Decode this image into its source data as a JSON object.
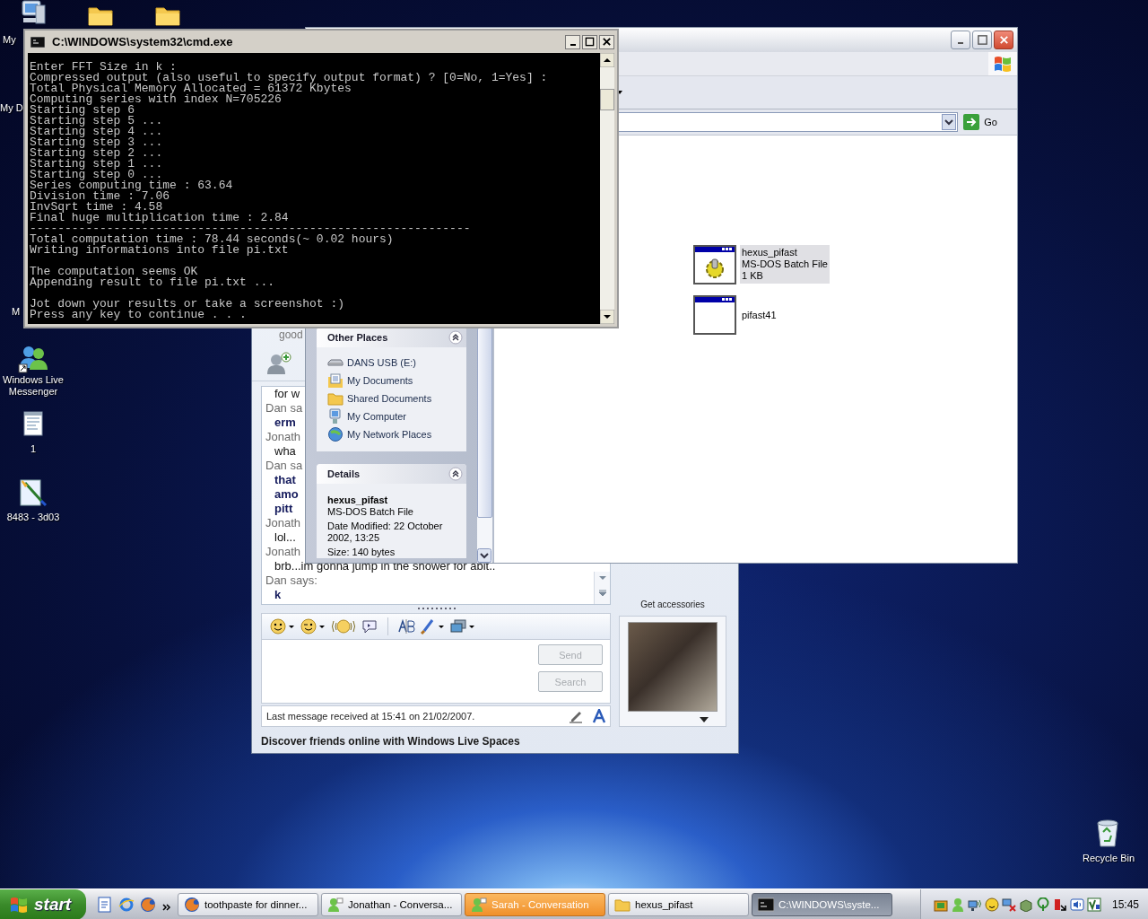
{
  "desktop_icons": [
    {
      "kind": "computer",
      "label": "My"
    },
    {
      "kind": "folder"
    },
    {
      "kind": "folder"
    },
    {
      "kind": "none",
      "label": "My D"
    },
    {
      "kind": "none",
      "label": "M"
    },
    {
      "kind": "messenger",
      "label": "Windows Live Messenger"
    },
    {
      "kind": "notepad",
      "label": "1"
    },
    {
      "kind": "paint",
      "label": "8483 - 3d03"
    },
    {
      "kind": "recycle_bin",
      "label": "Recycle Bin"
    }
  ],
  "messenger": {
    "personal_message": "good",
    "chat_log": [
      {
        "kind": "message",
        "text": "for w"
      },
      {
        "kind": "sender",
        "text": "Dan sa"
      },
      {
        "kind": "bold_message",
        "text": "erm"
      },
      {
        "kind": "sender",
        "text": "Jonath"
      },
      {
        "kind": "message",
        "text": "wha"
      },
      {
        "kind": "sender",
        "text": "Dan sa"
      },
      {
        "kind": "bold_message",
        "text": "that"
      },
      {
        "kind": "bold_message",
        "text": "amo"
      },
      {
        "kind": "bold_message",
        "text": "pitt"
      },
      {
        "kind": "sender",
        "text": "Jonath"
      },
      {
        "kind": "message",
        "text": "lol..."
      },
      {
        "kind": "sender",
        "text": "Jonath"
      },
      {
        "kind": "message",
        "text": "brb...im gonna jump in the shower for abit.."
      },
      {
        "kind": "sender",
        "text": "Dan says:"
      },
      {
        "kind": "bold_message",
        "text": "k"
      }
    ],
    "buttons": [
      {
        "label": "Send",
        "disabled": true
      },
      {
        "label": "Search",
        "disabled": true
      }
    ],
    "status": "Last message received at 15:41 on 21/02/2007.",
    "accessories_link": "Get accessories",
    "banner": "Discover friends online with Windows Live Spaces"
  },
  "explorer": {
    "other_places": {
      "title": "Other Places",
      "items": [
        {
          "kind": "drive",
          "label": "DANS USB (E:)"
        },
        {
          "kind": "documents",
          "label": "My Documents"
        },
        {
          "kind": "folder",
          "label": "Shared Documents"
        },
        {
          "kind": "computer",
          "label": "My Computer"
        },
        {
          "kind": "network",
          "label": "My Network Places"
        }
      ]
    },
    "details": {
      "title": "Details",
      "name": "hexus_pifast",
      "type": "MS-DOS Batch File",
      "modified": "Date Modified: 22 October 2002, 13:25",
      "size": "Size: 140 bytes"
    },
    "go_button": "Go",
    "files": [
      {
        "kind": "batch",
        "name": "hexus_pifast",
        "type": "MS-DOS Batch File",
        "size": "1 KB",
        "selected": true
      },
      {
        "kind": "program",
        "name": "pifast41",
        "selected": false
      }
    ]
  },
  "console": {
    "title": "C:\\WINDOWS\\system32\\cmd.exe",
    "blocks": [
      [
        "Enter FFT Size in k :",
        "Compressed output (also useful to specify output format) ? [0=No, 1=Yes] :",
        "Total Physical Memory Allocated = 61372 Kbytes",
        "Computing series with index N=705226",
        "Starting step 6",
        "Starting step 5 ...",
        "Starting step 4 ...",
        "Starting step 3 ...",
        "Starting step 2 ...",
        "Starting step 1 ...",
        "Starting step 0 ...",
        "Series computing time : 63.64",
        "Division time : 7.06",
        "InvSqrt time : 4.58",
        "Final huge multiplication time : 2.84",
        "---------------------------------------------------------------",
        "Total computation time : 78.44 seconds(~ 0.02 hours)",
        "Writing informations into file pi.txt"
      ],
      [
        "The computation seems OK",
        "Appending result to file pi.txt ..."
      ],
      [
        "Jot down your results or take a screenshot :)",
        "Press any key to continue . . ."
      ]
    ]
  },
  "taskbar": {
    "start": "start",
    "tasks": [
      {
        "kind": "browser",
        "label": "toothpaste for dinner...",
        "selected": false,
        "flashing": false
      },
      {
        "kind": "messenger",
        "label": "Jonathan - Conversa...",
        "selected": false,
        "flashing": false
      },
      {
        "kind": "messenger",
        "label": "Sarah - Conversation",
        "selected": false,
        "flashing": true
      },
      {
        "kind": "folder",
        "label": "hexus_pifast",
        "selected": false,
        "flashing": false
      },
      {
        "kind": "console",
        "label": "C:\\WINDOWS\\syste...",
        "selected": true,
        "flashing": false
      }
    ],
    "clock": "15:45"
  }
}
